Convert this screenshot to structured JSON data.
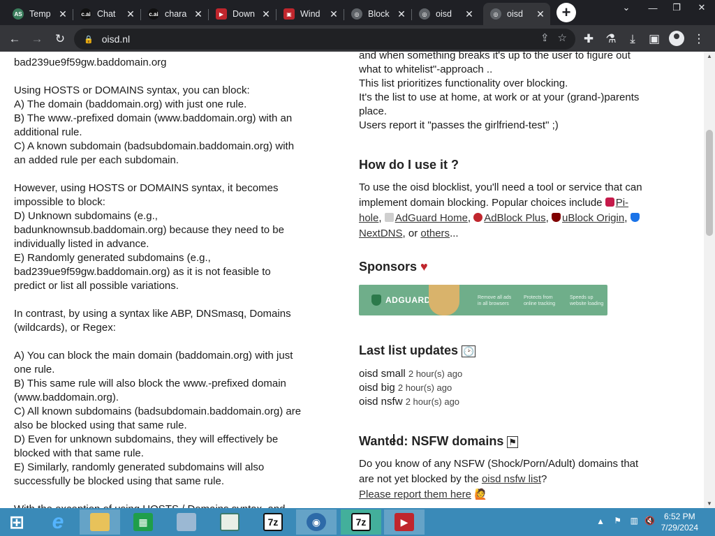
{
  "browser": {
    "tabs": [
      {
        "title": "Temp",
        "favicon_color": "#3a7d5c",
        "favicon_glyph": "AS",
        "active": false
      },
      {
        "title": "Chat",
        "favicon_color": "#111111",
        "favicon_glyph": "c.ai",
        "active": false
      },
      {
        "title": "chara",
        "favicon_color": "#111111",
        "favicon_glyph": "c.ai",
        "active": false
      },
      {
        "title": "Down",
        "favicon_color": "#c0262d",
        "favicon_glyph": "▶",
        "active": false
      },
      {
        "title": "Wind",
        "favicon_color": "#c0262d",
        "favicon_glyph": "▣",
        "active": false
      },
      {
        "title": "Block",
        "favicon_color": "#5f6368",
        "favicon_glyph": "◎",
        "active": false
      },
      {
        "title": "oisd",
        "favicon_color": "#5f6368",
        "favicon_glyph": "◎",
        "active": false
      },
      {
        "title": "oisd",
        "favicon_color": "#5f6368",
        "favicon_glyph": "◎",
        "active": true
      }
    ],
    "url": "oisd.nl"
  },
  "page": {
    "left_lines": [
      "bad239ue9f59gw.baddomain.org",
      "",
      "Using HOSTS or DOMAINS syntax, you can block:",
      "A) The domain (baddomain.org) with just one rule.",
      "B) The www.-prefixed domain (www.baddomain.org) with an",
      "additional rule.",
      "C) A known subdomain (badsubdomain.baddomain.org) with",
      "an added rule per each subdomain.",
      "",
      "However, using HOSTS or DOMAINS syntax, it becomes",
      "impossible to block:",
      "D) Unknown subdomains (e.g.,",
      "badunknownsub.baddomain.org) because they need to be",
      "individually listed in advance.",
      "E) Randomly generated subdomains (e.g.,",
      "bad239ue9f59gw.baddomain.org) as it is not feasible to",
      "predict or list all possible variations.",
      "",
      "In contrast, by using a syntax like ABP, DNSmasq, Domains",
      "(wildcards), or Regex:",
      "",
      "A) You can block the main domain (baddomain.org) with just",
      "one rule.",
      "B) This same rule will also block the www.-prefixed domain",
      "(www.baddomain.org).",
      "C) All known subdomains (badsubdomain.baddomain.org) are",
      "also be blocked using that same rule.",
      "D) Even for unknown subdomains, they will effectively be",
      "blocked with that same rule.",
      "E) Similarly, randomly generated subdomains will also",
      "successfully be blocked using that same rule.",
      "",
      "With the exception of using HOSTS / Domains syntax, and"
    ],
    "intro_lines": [
      "and when something breaks it's up to the user to figure out",
      "what to whitelist\"-approach ..",
      "This list prioritizes functionality over blocking.",
      "It's the list to use at home, at work or at your (grand-)parents",
      "place.",
      "Users report it \"passes the girlfriend-test\" ;)"
    ],
    "how_heading": "How do I use it ?",
    "how_line1": "To use the oisd blocklist, you'll need a tool or service that can",
    "how_line2_prefix": "implement domain blocking. Popular choices include ",
    "tools": {
      "pihole_a": "Pi-",
      "pihole_b": "hole",
      "adguard_home": "AdGuard Home",
      "adblock_plus": "AdBlock Plus",
      "ublock_origin": "uBlock Origin",
      "nextdns": "NextDNS",
      "or": ", or ",
      "others": "others",
      "ellipsis": "..."
    },
    "sponsors_heading": "Sponsors",
    "sponsor_banner": {
      "brand": "ADGUARD",
      "col1": "Remove all ads in all browsers",
      "col2": "Protects from online tracking",
      "col3": "Speeds up website loading"
    },
    "updates_heading": "Last list updates",
    "updates": [
      {
        "name": "oisd small",
        "ago": "2 hour(s) ago"
      },
      {
        "name": "oisd big",
        "ago": "2 hour(s) ago"
      },
      {
        "name": "oisd nsfw",
        "ago": "2 hour(s) ago"
      }
    ],
    "wanted_heading": "Wanted: NSFW domains",
    "wanted_line1": "Do you know of any NSFW (Shock/Porn/Adult) domains that",
    "wanted_line2_prefix": "are not yet blocked by the ",
    "wanted_link": "oisd nsfw list",
    "wanted_line2_suffix": "?",
    "report_link": "Please report them here"
  },
  "taskbar": {
    "time": "6:52 PM",
    "date": "7/29/2024",
    "items": [
      {
        "name": "start-button",
        "color": "#ffffff",
        "glyph": "⊞"
      },
      {
        "name": "internet-explorer",
        "color": "#1e90ff",
        "glyph": "e"
      },
      {
        "name": "file-explorer",
        "color": "#e8c25a",
        "glyph": "▭"
      },
      {
        "name": "store",
        "color": "#1f9e4a",
        "glyph": "▦"
      },
      {
        "name": "monitor-app",
        "color": "#9bb8d3",
        "glyph": "▤"
      },
      {
        "name": "notepad-app",
        "color": "#3c7a6e",
        "glyph": "≣"
      },
      {
        "name": "7zip-1",
        "color": "#111111",
        "glyph": "7z"
      },
      {
        "name": "browser-app",
        "color": "#2d6aa8",
        "glyph": "◉"
      },
      {
        "name": "7zip-2",
        "color": "#111111",
        "glyph": "7z"
      },
      {
        "name": "video-app",
        "color": "#c0262d",
        "glyph": "▶"
      }
    ]
  }
}
